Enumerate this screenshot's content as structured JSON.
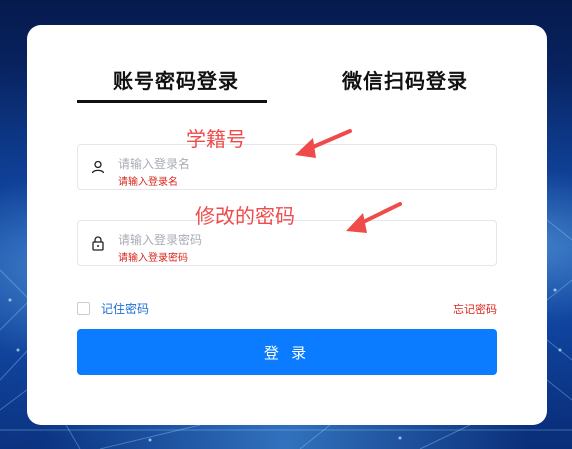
{
  "tabs": [
    {
      "label": "账号密码登录",
      "active": true
    },
    {
      "label": "微信扫码登录",
      "active": false
    }
  ],
  "username": {
    "placeholder": "请输入登录名",
    "error": "请输入登录名",
    "icon": "user-icon"
  },
  "password": {
    "placeholder": "请输入登录密码",
    "error": "请输入登录密码",
    "icon": "lock-icon"
  },
  "annotations": {
    "username_note": "学籍号",
    "password_note": "修改的密码"
  },
  "remember_label": "记住密码",
  "forgot_label": "忘记密码",
  "login_label": "登 录",
  "colors": {
    "primary": "#0b7cff",
    "error": "#d9261c",
    "annotation": "#ef4b4b",
    "link": "#1c6fd1"
  }
}
